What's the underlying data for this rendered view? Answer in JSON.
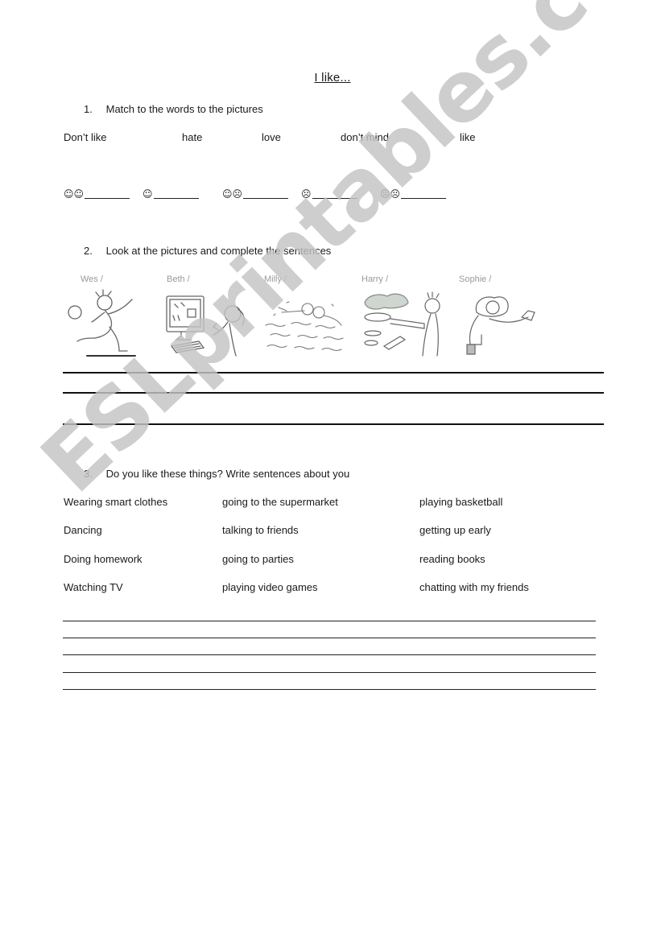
{
  "title": "I like...",
  "exercise1": {
    "number": "1.",
    "instruction": "Match to the words to the pictures",
    "words": [
      "Don’t like",
      "hate",
      "love",
      "don’t mind",
      "like"
    ],
    "faces": [
      {
        "icons": "☺☺",
        "meaning": "two-happy-faces",
        "blank": ""
      },
      {
        "icons": "☺",
        "meaning": "one-happy-face",
        "blank": ""
      },
      {
        "icons": "☺☹",
        "meaning": "happy-and-sad-face",
        "blank": ""
      },
      {
        "icons": "☹",
        "meaning": "one-sad-face",
        "blank": ""
      },
      {
        "icons": "☹☹",
        "meaning": "two-sad-faces",
        "blank": ""
      }
    ]
  },
  "exercise2": {
    "number": "2.",
    "instruction": "Look at the pictures and complete the sentences",
    "pictures": [
      {
        "label": "Wes /",
        "depicts": "boy kicking a ball"
      },
      {
        "label": "Beth /",
        "depicts": "girl using a computer"
      },
      {
        "label": "Milly /",
        "depicts": "girl swimming"
      },
      {
        "label": "Harry /",
        "depicts": "boy cooking with a frying pan"
      },
      {
        "label": "Sophie /",
        "depicts": "girl reading"
      }
    ],
    "answer_lines": 3
  },
  "exercise3": {
    "number": "3.",
    "instruction": "Do you like these things? Write sentences about you",
    "columns": [
      [
        "Wearing smart clothes",
        "Dancing",
        "Doing homework",
        "Watching TV"
      ],
      [
        "going to the supermarket",
        "talking to friends",
        "going to parties",
        "playing video games"
      ],
      [
        "playing basketball",
        "getting up early",
        "reading books",
        "chatting with my friends"
      ]
    ],
    "answer_lines": 5
  },
  "watermark": "ESLprintables.com"
}
